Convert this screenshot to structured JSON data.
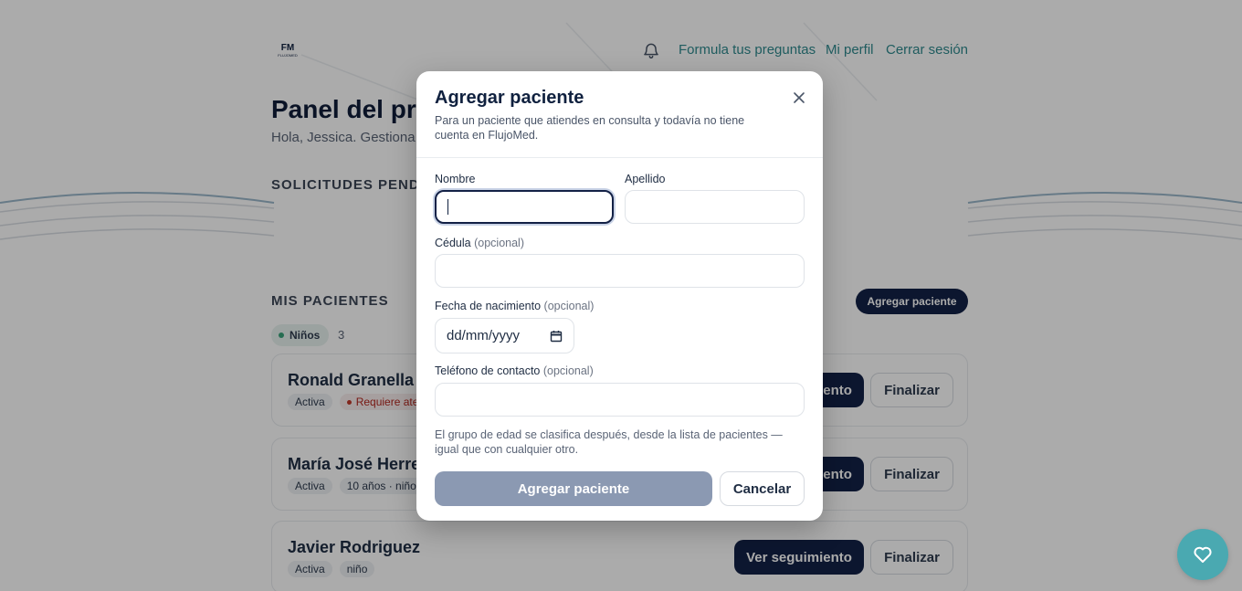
{
  "header": {
    "logo_text": "FLUJOMED",
    "nav": [
      {
        "label": "Formula tus preguntas"
      },
      {
        "label": "Mi perfil"
      },
      {
        "label": "Cerrar sesión"
      }
    ]
  },
  "page": {
    "title": "Panel del profesional",
    "subtitle": "Hola, Jessica. Gestiona tus pacientes",
    "pending_section": "SOLICITUDES PENDIENTES",
    "patients_section": "MIS PACIENTES",
    "add_patient_label": "Agregar paciente",
    "group": {
      "label": "Niños",
      "count": "3"
    }
  },
  "patients": [
    {
      "name": "Ronald Granella",
      "status": "Activa",
      "alert": "Requiere atención",
      "follow_label": "Ver seguimiento",
      "finish_label": "Finalizar"
    },
    {
      "name": "María José Herrera",
      "status": "Activa",
      "info": "10 años · niño",
      "follow_label": "Ver seguimiento",
      "finish_label": "Finalizar"
    },
    {
      "name": "Javier Rodriguez",
      "status": "Activa",
      "info": "niño",
      "follow_label": "Ver seguimiento",
      "finish_label": "Finalizar"
    }
  ],
  "modal": {
    "title": "Agregar paciente",
    "description": "Para un paciente que atiendes en consulta y todavía no tiene cuenta en FlujoMed.",
    "fields": {
      "nombre": {
        "label": "Nombre",
        "value": ""
      },
      "apellido": {
        "label": "Apellido",
        "value": ""
      },
      "cedula": {
        "label": "Cédula",
        "optional": "(opcional)",
        "value": ""
      },
      "fecha": {
        "label": "Fecha de nacimiento",
        "optional": "(opcional)",
        "placeholder": "dd/mm/yyyy"
      },
      "telefono": {
        "label": "Teléfono de contacto",
        "optional": "(opcional)",
        "value": ""
      }
    },
    "note": "El grupo de edad se clasifica después, desde la lista de pacientes — igual que con cualquier otro.",
    "submit_label": "Agregar paciente",
    "cancel_label": "Cancelar"
  },
  "colors": {
    "primary": "#132146",
    "accent": "#2f8a8e",
    "fab": "#4aa9b1",
    "disabled_button": "#8b99b2",
    "alert": "#b3261e"
  },
  "icons": [
    "bell-icon",
    "close-icon",
    "calendar-icon",
    "heart-icon"
  ]
}
